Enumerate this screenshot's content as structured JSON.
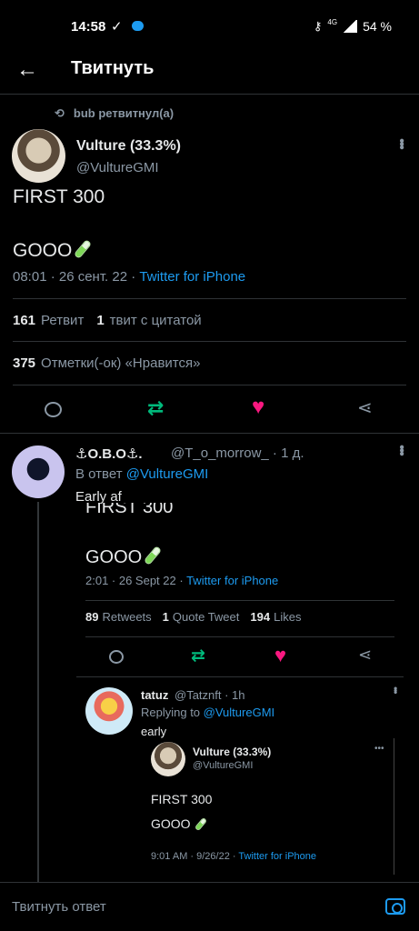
{
  "status": {
    "time": "14:58",
    "network": "4G",
    "battery": "54 %"
  },
  "header": {
    "title": "Твитнуть"
  },
  "retweet_line": {
    "text": "bub ретвитнул(а)"
  },
  "main_tweet": {
    "name": "Vulture (33.3%)",
    "handle": "@VultureGMI",
    "text_line1": "FIRST 300",
    "text_line2": "GOOO",
    "time": "08:01 · 26 сент. 22 ·",
    "source": "Twitter for iPhone",
    "retweets_count": "161",
    "retweets_label": "Ретвит",
    "quotes_count": "1",
    "quotes_label": "твит с цитатой",
    "likes_count": "375",
    "likes_label": "Отметки(-ок) «Нравится»"
  },
  "reply": {
    "name": "⚓O.B.O⚓.",
    "handle": "@T_o_morrow_ · 1 д.",
    "reply_prefix": "В ответ",
    "reply_to": "@VultureGMI",
    "text": "Early af",
    "screenshot": {
      "clipped_text": "FIRST 300",
      "line": "GOOO",
      "time": "2:01 · 26 Sept 22 ·",
      "source": "Twitter for iPhone",
      "retweets_count": "89",
      "retweets_label": "Retweets",
      "quotes_count": "1",
      "quotes_label": "Quote Tweet",
      "likes_count": "194",
      "likes_label": "Likes",
      "nested": {
        "name": "tatuz",
        "handle": "@Tatznft · 1h",
        "reply_prefix": "Replying to",
        "reply_to": "@VultureGMI",
        "text": "early",
        "quoted_name": "Vulture (33.3%)",
        "quoted_handle": "@VultureGMI",
        "quoted_line1": "FIRST 300",
        "quoted_line2": "GOOO",
        "quoted_time": "9:01 AM · 9/26/22 ·",
        "quoted_source": "Twitter for iPhone"
      }
    }
  },
  "composer": {
    "placeholder": "Твитнуть ответ"
  }
}
